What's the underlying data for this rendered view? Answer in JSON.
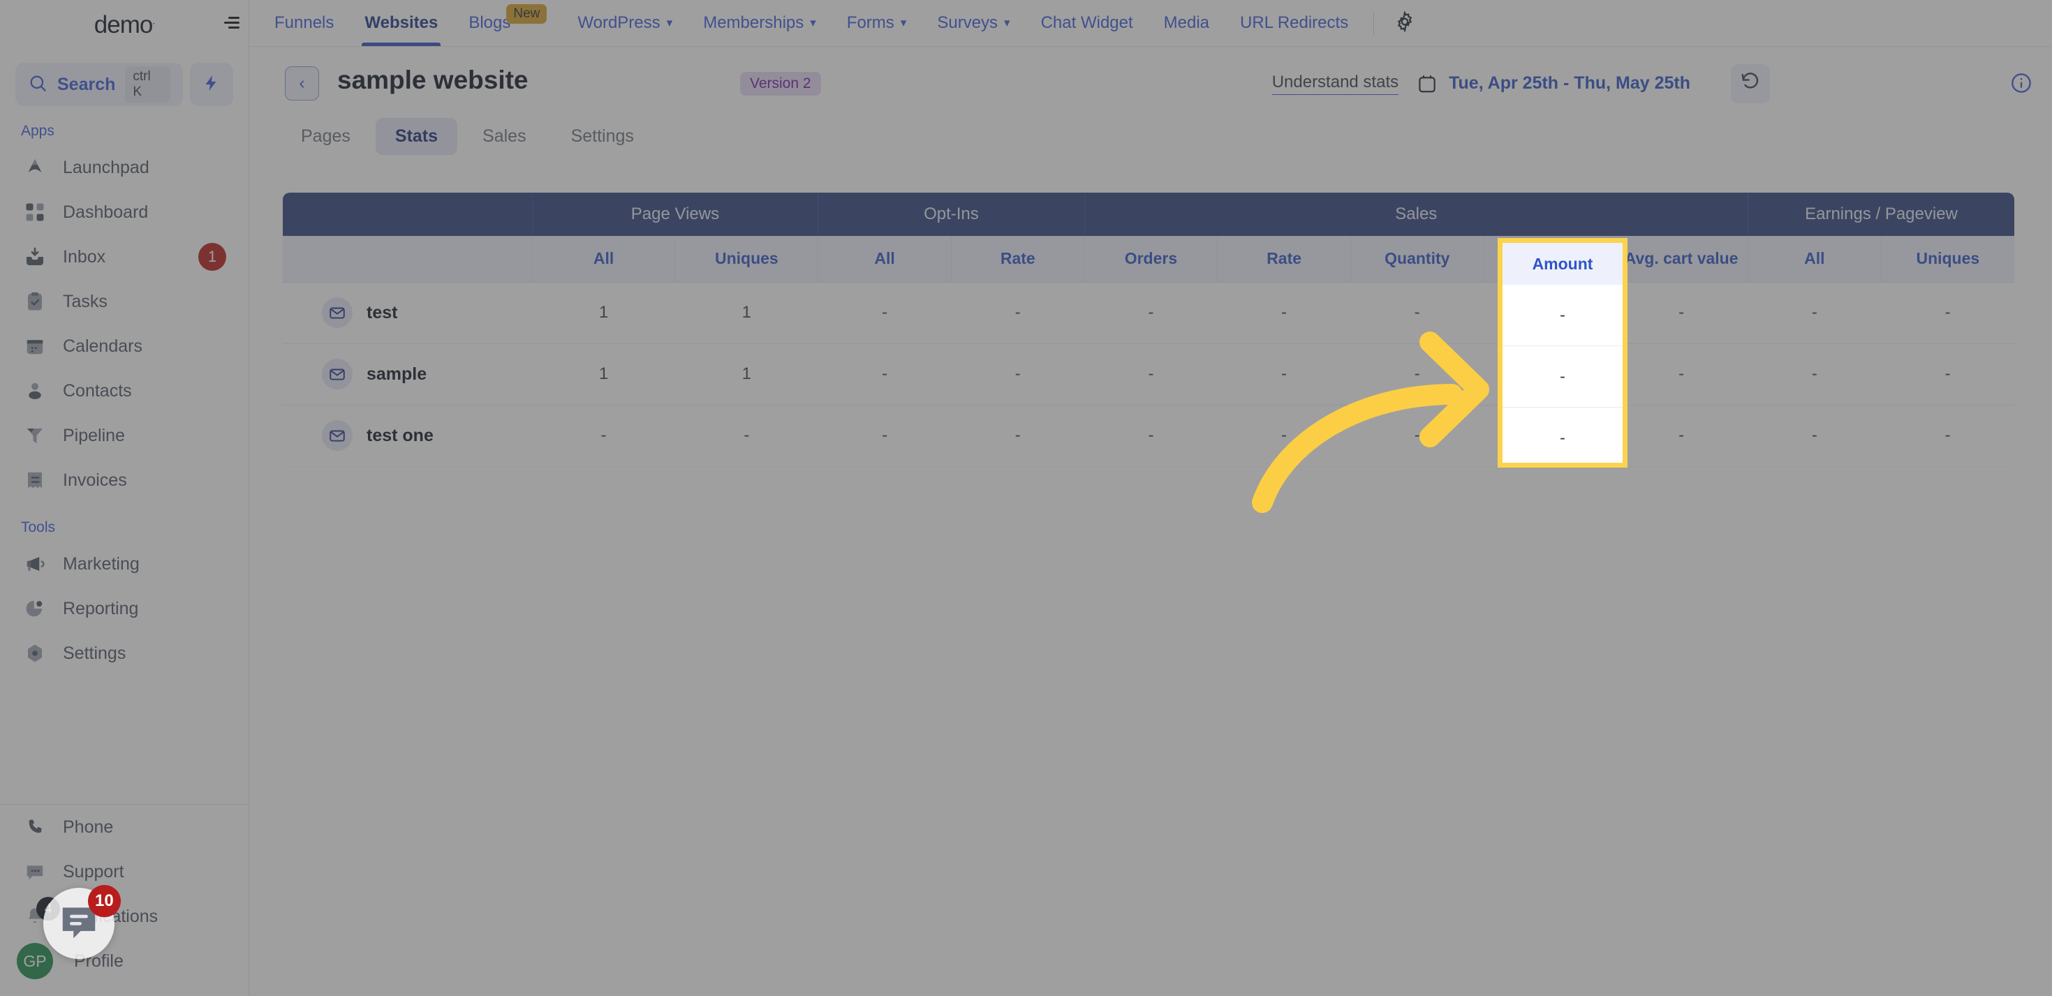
{
  "brand": {
    "name": "demo",
    "mark": "."
  },
  "sidebar": {
    "search": {
      "label": "Search",
      "shortcut": "ctrl K",
      "icon": "search-icon"
    },
    "bolt_icon": "bolt-icon",
    "sections": [
      {
        "label": "Apps",
        "items": [
          {
            "label": "Launchpad",
            "icon": "launchpad-icon",
            "badge": ""
          },
          {
            "label": "Dashboard",
            "icon": "dashboard-icon",
            "badge": ""
          },
          {
            "label": "Inbox",
            "icon": "inbox-icon",
            "badge": "1"
          },
          {
            "label": "Tasks",
            "icon": "tasks-icon",
            "badge": ""
          },
          {
            "label": "Calendars",
            "icon": "calendar-icon",
            "badge": ""
          },
          {
            "label": "Contacts",
            "icon": "contacts-icon",
            "badge": ""
          },
          {
            "label": "Pipeline",
            "icon": "pipeline-icon",
            "badge": ""
          },
          {
            "label": "Invoices",
            "icon": "invoices-icon",
            "badge": ""
          }
        ]
      },
      {
        "label": "Tools",
        "items": [
          {
            "label": "Marketing",
            "icon": "megaphone-icon",
            "badge": ""
          },
          {
            "label": "Reporting",
            "icon": "piechart-icon",
            "badge": ""
          },
          {
            "label": "Settings",
            "icon": "gear-icon",
            "badge": ""
          }
        ]
      }
    ],
    "footer_items": [
      {
        "label": "Phone",
        "icon": "phone-icon",
        "badge": ""
      },
      {
        "label": "Support",
        "icon": "chat-icon",
        "badge": ""
      },
      {
        "label": "Notifications",
        "icon": "bell-icon",
        "badge": "4"
      },
      {
        "label": "Profile",
        "icon": "avatar-icon",
        "badge": "",
        "avatar_initials": "GP"
      }
    ]
  },
  "topnav": {
    "collapse_icon": "collapse-menu-icon",
    "items": [
      {
        "label": "Funnels",
        "has_caret": false,
        "active": false,
        "pill": ""
      },
      {
        "label": "Websites",
        "has_caret": false,
        "active": true,
        "pill": ""
      },
      {
        "label": "Blogs",
        "has_caret": false,
        "active": false,
        "pill": "New"
      },
      {
        "label": "WordPress",
        "has_caret": true,
        "active": false,
        "pill": ""
      },
      {
        "label": "Memberships",
        "has_caret": true,
        "active": false,
        "pill": ""
      },
      {
        "label": "Forms",
        "has_caret": true,
        "active": false,
        "pill": ""
      },
      {
        "label": "Surveys",
        "has_caret": true,
        "active": false,
        "pill": ""
      },
      {
        "label": "Chat Widget",
        "has_caret": false,
        "active": false,
        "pill": ""
      },
      {
        "label": "Media",
        "has_caret": false,
        "active": false,
        "pill": ""
      },
      {
        "label": "URL Redirects",
        "has_caret": false,
        "active": false,
        "pill": ""
      }
    ],
    "gear_icon": "gear-icon"
  },
  "header": {
    "back_icon": "chevron-left-icon",
    "title": "sample website",
    "version_badge": "Version 2",
    "understand_link": "Understand stats",
    "calendar_icon": "calendar-icon",
    "date_range": "Tue, Apr 25th - Thu, May 25th",
    "refresh_icon": "refresh-icon",
    "info_icon": "info-icon"
  },
  "subtabs": [
    {
      "label": "Pages",
      "active": false
    },
    {
      "label": "Stats",
      "active": true
    },
    {
      "label": "Sales",
      "active": false
    },
    {
      "label": "Settings",
      "active": false
    }
  ],
  "table": {
    "group_headers": [
      {
        "label": "",
        "span": 1
      },
      {
        "label": "Page Views",
        "span": 2
      },
      {
        "label": "Opt-Ins",
        "span": 2
      },
      {
        "label": "Sales",
        "span": 5
      },
      {
        "label": "Earnings / Pageview",
        "span": 2
      }
    ],
    "sub_headers": [
      "",
      "All",
      "Uniques",
      "All",
      "Rate",
      "Orders",
      "Rate",
      "Quantity",
      "Amount",
      "Avg. cart value",
      "All",
      "Uniques"
    ],
    "row_icon": "mail-icon",
    "rows": [
      {
        "name": "test",
        "cells": [
          "1",
          "1",
          "-",
          "-",
          "-",
          "-",
          "-",
          "-",
          "-",
          "-",
          "-"
        ]
      },
      {
        "name": "sample",
        "cells": [
          "1",
          "1",
          "-",
          "-",
          "-",
          "-",
          "-",
          "-",
          "-",
          "-",
          "-"
        ]
      },
      {
        "name": "test one",
        "cells": [
          "-",
          "-",
          "-",
          "-",
          "-",
          "-",
          "-",
          "-",
          "-",
          "-",
          "-"
        ]
      }
    ]
  },
  "spotlight": {
    "column_label": "Amount",
    "values": [
      "-",
      "-",
      "-"
    ],
    "border_color": "#fcd34d",
    "arrow_color": "#fbce45"
  },
  "chat_widget": {
    "icon": "chat-bubble-icon",
    "badge": "10"
  },
  "colors": {
    "header_blue": "#2f4480",
    "accent_blue": "#2f55c7",
    "highlight_yellow": "#fcd34d",
    "badge_red": "#b91c1c",
    "version_purple": "#6b21a8"
  }
}
